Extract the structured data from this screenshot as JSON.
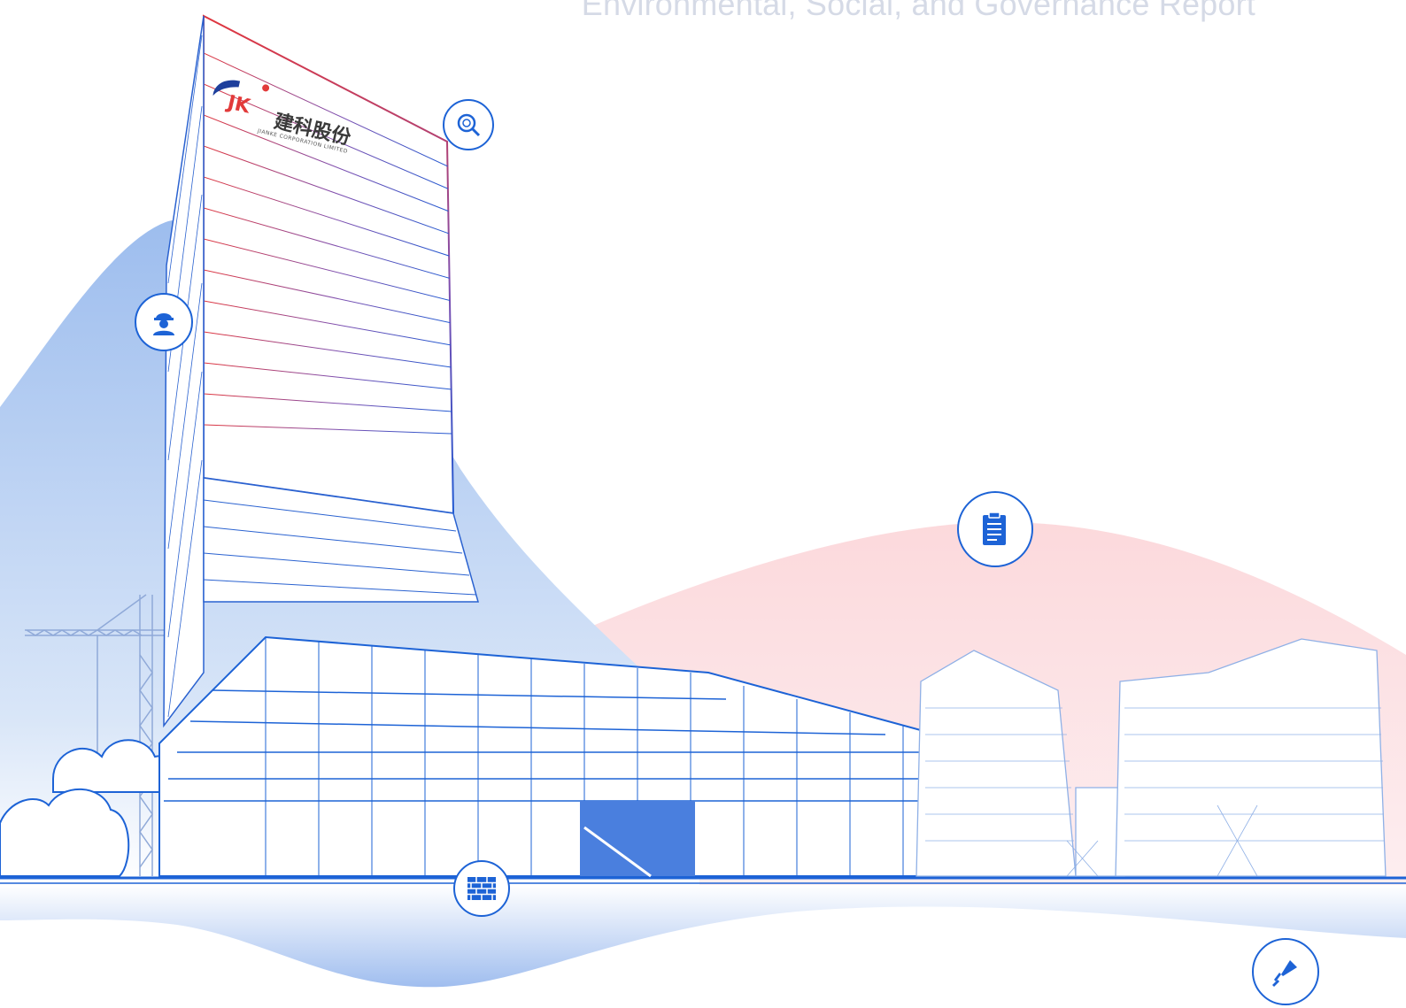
{
  "header": {
    "title": "Environmental, Social, and Governance Report"
  },
  "logo": {
    "text": "建科股份",
    "subtitle": "JIANKE CORPORATION LIMITED"
  },
  "colors": {
    "primary_blue": "#1d63d6",
    "accent_red": "#e23a3a",
    "pink_wave": "#fbdde0",
    "blue_wave": "#bcd3f4"
  },
  "icons": {
    "search": "magnifier-icon",
    "worker": "worker-helmet-icon",
    "document": "clipboard-document-icon",
    "brick": "brick-wall-icon",
    "tool": "trowel-tool-icon"
  }
}
